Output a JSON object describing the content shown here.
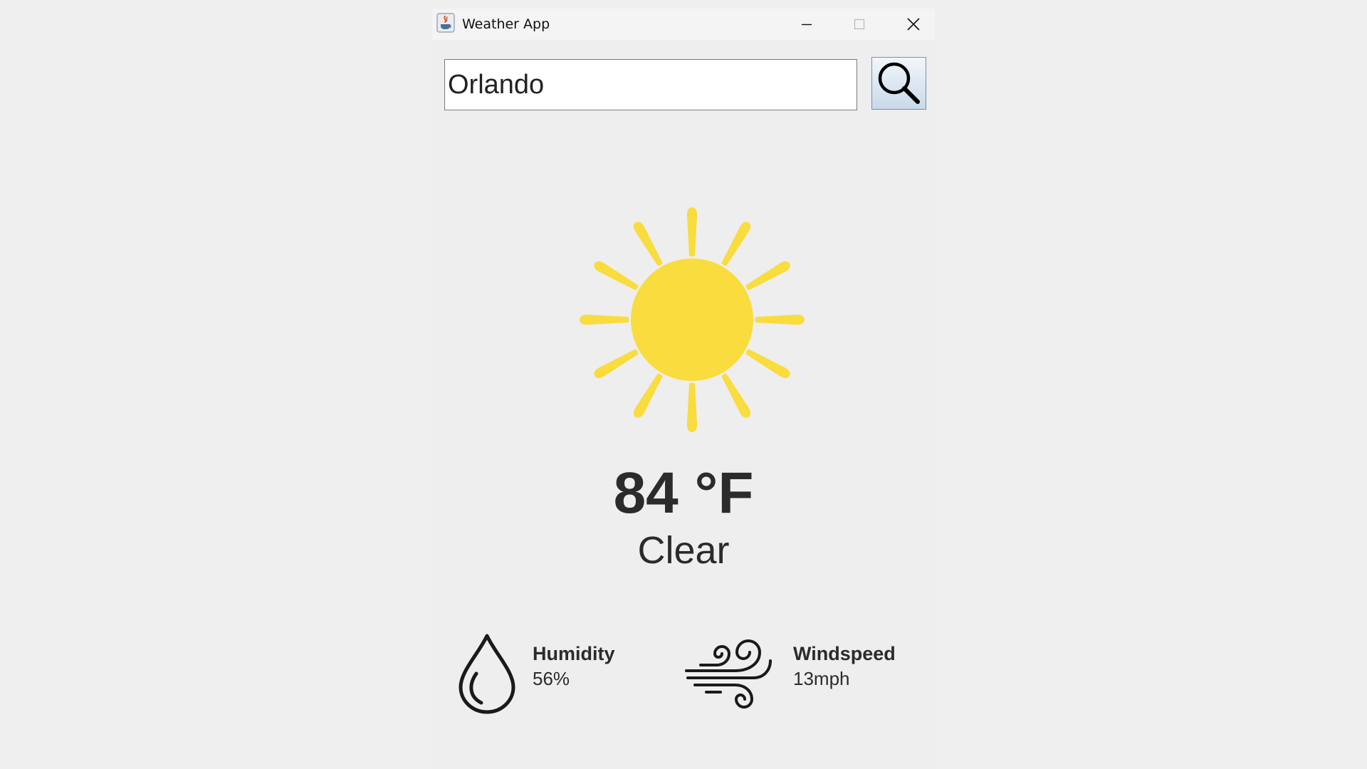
{
  "window": {
    "title": "Weather App",
    "icon": "java-cup-icon",
    "controls": [
      "minimize-icon",
      "maximize-icon",
      "close-icon"
    ]
  },
  "search": {
    "value": "Orlando",
    "button_icon": "search-icon"
  },
  "weather": {
    "icon": "sun-icon",
    "temperature": "84 °F",
    "condition": "Clear"
  },
  "stats": {
    "humidity": {
      "label": "Humidity",
      "value": "56%",
      "icon": "droplet-icon"
    },
    "windspeed": {
      "label": "Windspeed",
      "value": "13mph",
      "icon": "wind-icon"
    }
  },
  "colors": {
    "background": "#eeeeee",
    "sun": "#f9dc3e",
    "text": "#2b2b2b"
  }
}
